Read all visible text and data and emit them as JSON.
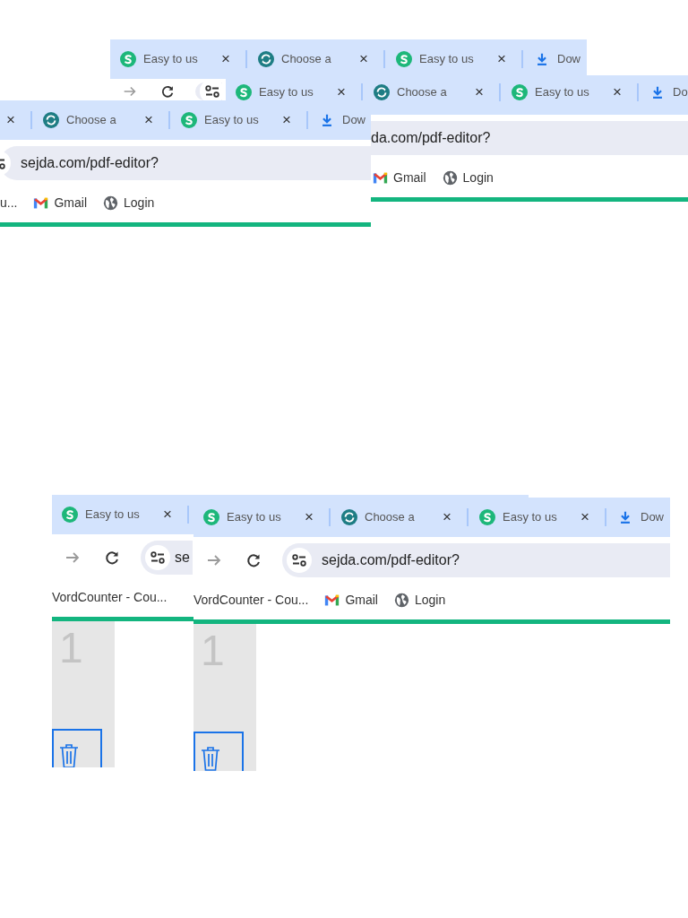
{
  "fragments": [
    {
      "tabs": [
        {
          "title": "Easy to us",
          "close": "×"
        },
        {
          "title": "Choose a",
          "close": "×"
        },
        {
          "title": "Easy to us",
          "close": "×"
        },
        {
          "title": "Dow"
        }
      ]
    },
    {
      "tabs": [
        {
          "title": "Easy to us",
          "close": "×"
        },
        {
          "title": "Choose a",
          "close": "×"
        },
        {
          "title": "Easy to us",
          "close": "×"
        },
        {
          "title": "Do"
        }
      ],
      "nav": {
        "url": "da.com/pdf-editor?"
      },
      "bookmarks": [
        {
          "label": "Gmail"
        },
        {
          "label": "Login"
        }
      ]
    },
    {
      "tabs": [
        {
          "close": "×"
        },
        {
          "title": "Choose a",
          "close": "×"
        },
        {
          "title": "Easy to us",
          "close": "×"
        },
        {
          "title": "Dow"
        }
      ],
      "nav": {
        "url": "sejda.com/pdf-editor?"
      },
      "bookmarks": [
        {
          "label": "u..."
        },
        {
          "label": "Gmail"
        },
        {
          "label": "Login"
        }
      ]
    },
    {
      "tabs": [
        {
          "title": "Easy to us",
          "close": "×"
        }
      ],
      "nav": {
        "url": "se"
      },
      "bookmarks": [
        {
          "label": "VordCounter - Cou..."
        }
      ],
      "page": {
        "page_number": "1"
      }
    },
    {
      "tabs": [
        {
          "title": "Easy to us",
          "close": "×"
        },
        {
          "title": "Choose a",
          "close": "×"
        },
        {
          "title": "Easy to us",
          "close": "×"
        },
        {
          "title": "Dow"
        }
      ],
      "nav": {
        "url": "sejda.com/pdf-editor?"
      },
      "bookmarks": [
        {
          "label": "VordCounter - Cou..."
        },
        {
          "label": "Gmail"
        },
        {
          "label": "Login"
        }
      ],
      "page": {
        "page_number": "1"
      }
    }
  ]
}
